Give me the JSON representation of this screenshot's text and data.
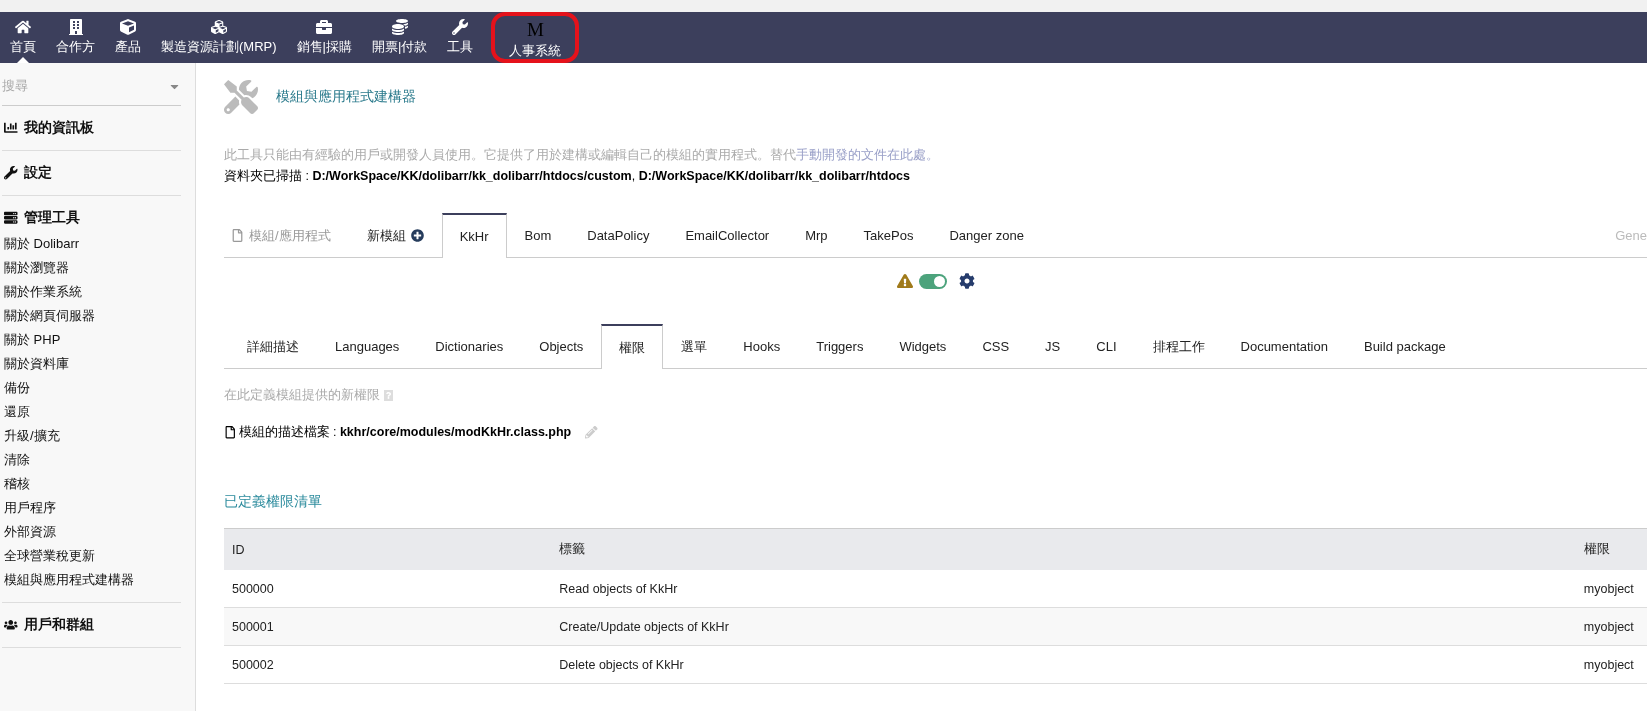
{
  "top_menu": [
    {
      "label": "首頁",
      "selected": true,
      "highlighted": false
    },
    {
      "label": "合作方",
      "selected": false,
      "highlighted": false
    },
    {
      "label": "產品",
      "selected": false,
      "highlighted": false
    },
    {
      "label": "製造資源計劃(MRP)",
      "selected": false,
      "highlighted": false
    },
    {
      "label": "銷售|採購",
      "selected": false,
      "highlighted": false
    },
    {
      "label": "開票|付款",
      "selected": false,
      "highlighted": false
    },
    {
      "label": "工具",
      "selected": false,
      "highlighted": false
    },
    {
      "label": "人事系統",
      "icon_text": "M",
      "selected": false,
      "highlighted": true
    }
  ],
  "sidebar": {
    "search": {
      "placeholder": "搜尋"
    },
    "sections": [
      {
        "title": "我的資訊板"
      },
      {
        "title": "設定"
      },
      {
        "title": "管理工具",
        "items": [
          "關於 Dolibarr",
          "關於瀏覽器",
          "關於作業系統",
          "關於網頁伺服器",
          "關於 PHP",
          "關於資料庫",
          "備份",
          "還原",
          "升級/擴充",
          "清除",
          "稽核",
          "用戶程序",
          "外部資源",
          "全球營業稅更新",
          "模組與應用程式建構器"
        ]
      },
      {
        "title": "用戶和群組"
      }
    ]
  },
  "page": {
    "title": "模組與應用程式建構器",
    "description": "此工具只能由有經驗的用戶或開發人員使用。它提供了用於建構或編輯自己的模組的實用程式。替代",
    "description_link": "手動開發的文件在此處。",
    "scanned": "資料夾已掃描 : **D:/WorkSpace/KK/dolibarr/kk_dolibarr/htdocs/custom**, **D:/WorkSpace/KK/dolibarr/kk_dolibarr/htdocs**"
  },
  "module_tabs": [
    {
      "label": "模組/應用程式",
      "kind": "file",
      "selected": false
    },
    {
      "label": "新模組",
      "kind": "new",
      "selected": false
    },
    {
      "label": "KkHr",
      "kind": "tab",
      "selected": true
    },
    {
      "label": "Bom",
      "kind": "tab",
      "selected": false
    },
    {
      "label": "DataPolicy",
      "kind": "tab",
      "selected": false
    },
    {
      "label": "EmailCollector",
      "kind": "tab",
      "selected": false
    },
    {
      "label": "Mrp",
      "kind": "tab",
      "selected": false
    },
    {
      "label": "TakePos",
      "kind": "tab",
      "selected": false
    },
    {
      "label": "Danger zone",
      "kind": "tab",
      "selected": false
    }
  ],
  "module_tabs_right": "Gene",
  "module_status": {
    "on": true
  },
  "sub_tabs": [
    {
      "label": "詳細描述",
      "selected": false
    },
    {
      "label": "Languages",
      "selected": false
    },
    {
      "label": "Dictionaries",
      "selected": false
    },
    {
      "label": "Objects",
      "selected": false
    },
    {
      "label": "權限",
      "selected": true
    },
    {
      "label": "選單",
      "selected": false
    },
    {
      "label": "Hooks",
      "selected": false
    },
    {
      "label": "Triggers",
      "selected": false
    },
    {
      "label": "Widgets",
      "selected": false
    },
    {
      "label": "CSS",
      "selected": false
    },
    {
      "label": "JS",
      "selected": false
    },
    {
      "label": "CLI",
      "selected": false
    },
    {
      "label": "排程工作",
      "selected": false
    },
    {
      "label": "Documentation",
      "selected": false
    },
    {
      "label": "Build package",
      "selected": false
    }
  ],
  "permissions": {
    "hint": "在此定義模組提供的新權限",
    "file_label": "模組的描述檔案 : ",
    "file_path": "kkhr/core/modules/modKkHr.class.php",
    "list_title": "已定義權限清單",
    "table": {
      "columns": [
        "ID",
        "標籤",
        "權限"
      ],
      "rows": [
        [
          "500000",
          "Read objects of KkHr",
          "myobject"
        ],
        [
          "500001",
          "Create/Update objects of KkHr",
          "myobject"
        ],
        [
          "500002",
          "Delete objects of KkHr",
          "myobject"
        ]
      ]
    }
  }
}
